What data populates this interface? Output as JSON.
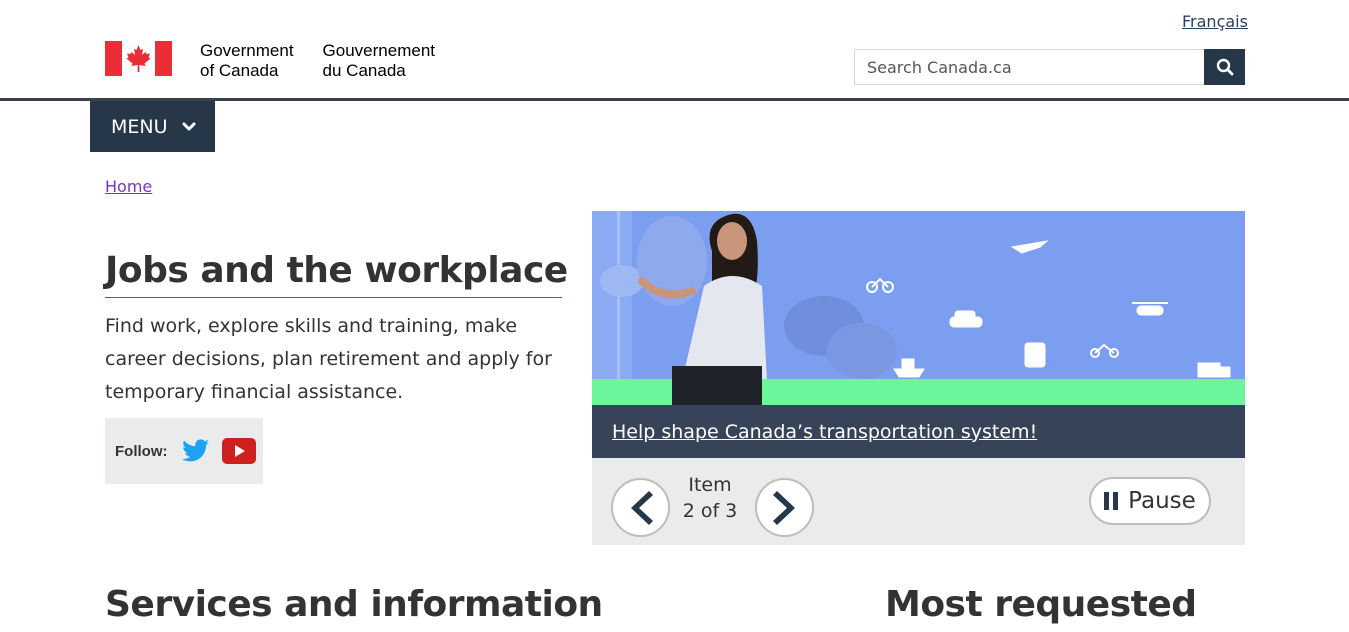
{
  "header": {
    "language_link": "Français",
    "brand_en_line1": "Government",
    "brand_en_line2": "of Canada",
    "brand_fr_line1": "Gouvernement",
    "brand_fr_line2": "du Canada",
    "search_placeholder": "Search Canada.ca",
    "menu_label": "MENU"
  },
  "breadcrumb": {
    "home": "Home"
  },
  "main": {
    "title": "Jobs and the workplace",
    "intro": "Find work, explore skills and training, make career decisions, plan retirement and apply for temporary financial assistance.",
    "follow_label": "Follow:"
  },
  "carousel": {
    "caption": "Help shape Canada’s transportation system!",
    "item_word": "Item",
    "item_position": "2 of 3",
    "pause_label": "Pause"
  },
  "sections": {
    "left_heading": "Services and information",
    "right_heading": "Most requested"
  },
  "colors": {
    "nav_dark": "#26374a",
    "flag_red": "#eb2d37",
    "visited_link": "#7834bc",
    "title_rule": "#af3c43",
    "caption_bg": "#364358"
  },
  "icons": {
    "search": "search-icon",
    "menu": "chevron-down-icon",
    "twitter": "twitter-icon",
    "youtube": "youtube-icon",
    "prev": "chevron-left-icon",
    "next": "chevron-right-icon",
    "pause": "pause-icon"
  }
}
